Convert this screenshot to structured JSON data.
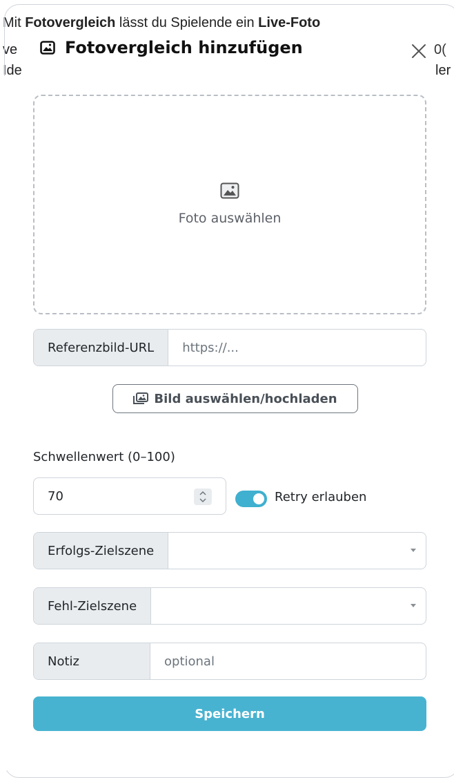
{
  "background": {
    "line1_parts": [
      "Mit ",
      "Fotovergleich",
      " lässt du Spielende ein ",
      "Live-Foto"
    ],
    "peek_left_2": "ve",
    "peek_left_3": "Ide",
    "peek_right_2": "0(",
    "peek_right_3": "ler"
  },
  "modal": {
    "title": "Fotovergleich hinzufügen",
    "title_icon": "image-icon",
    "close_icon": "close-icon"
  },
  "dropzone": {
    "label": "Foto auswählen",
    "icon": "image-icon"
  },
  "reference_url": {
    "label": "Referenzbild-URL",
    "placeholder": "https://..."
  },
  "upload_button": {
    "label": "Bild auswählen/hochladen",
    "icon": "images-icon"
  },
  "threshold": {
    "label": "Schwellenwert (0–100)",
    "value": "70"
  },
  "retry": {
    "label": "Retry erlauben",
    "enabled": true,
    "accent": "#3fb0cf"
  },
  "success_scene": {
    "label": "Erfolgs-Zielszene",
    "value": ""
  },
  "fail_scene": {
    "label": "Fehl-Zielszene",
    "value": ""
  },
  "note": {
    "label": "Notiz",
    "placeholder": "optional"
  },
  "save_button": {
    "label": "Speichern",
    "color": "#48b3d0"
  }
}
